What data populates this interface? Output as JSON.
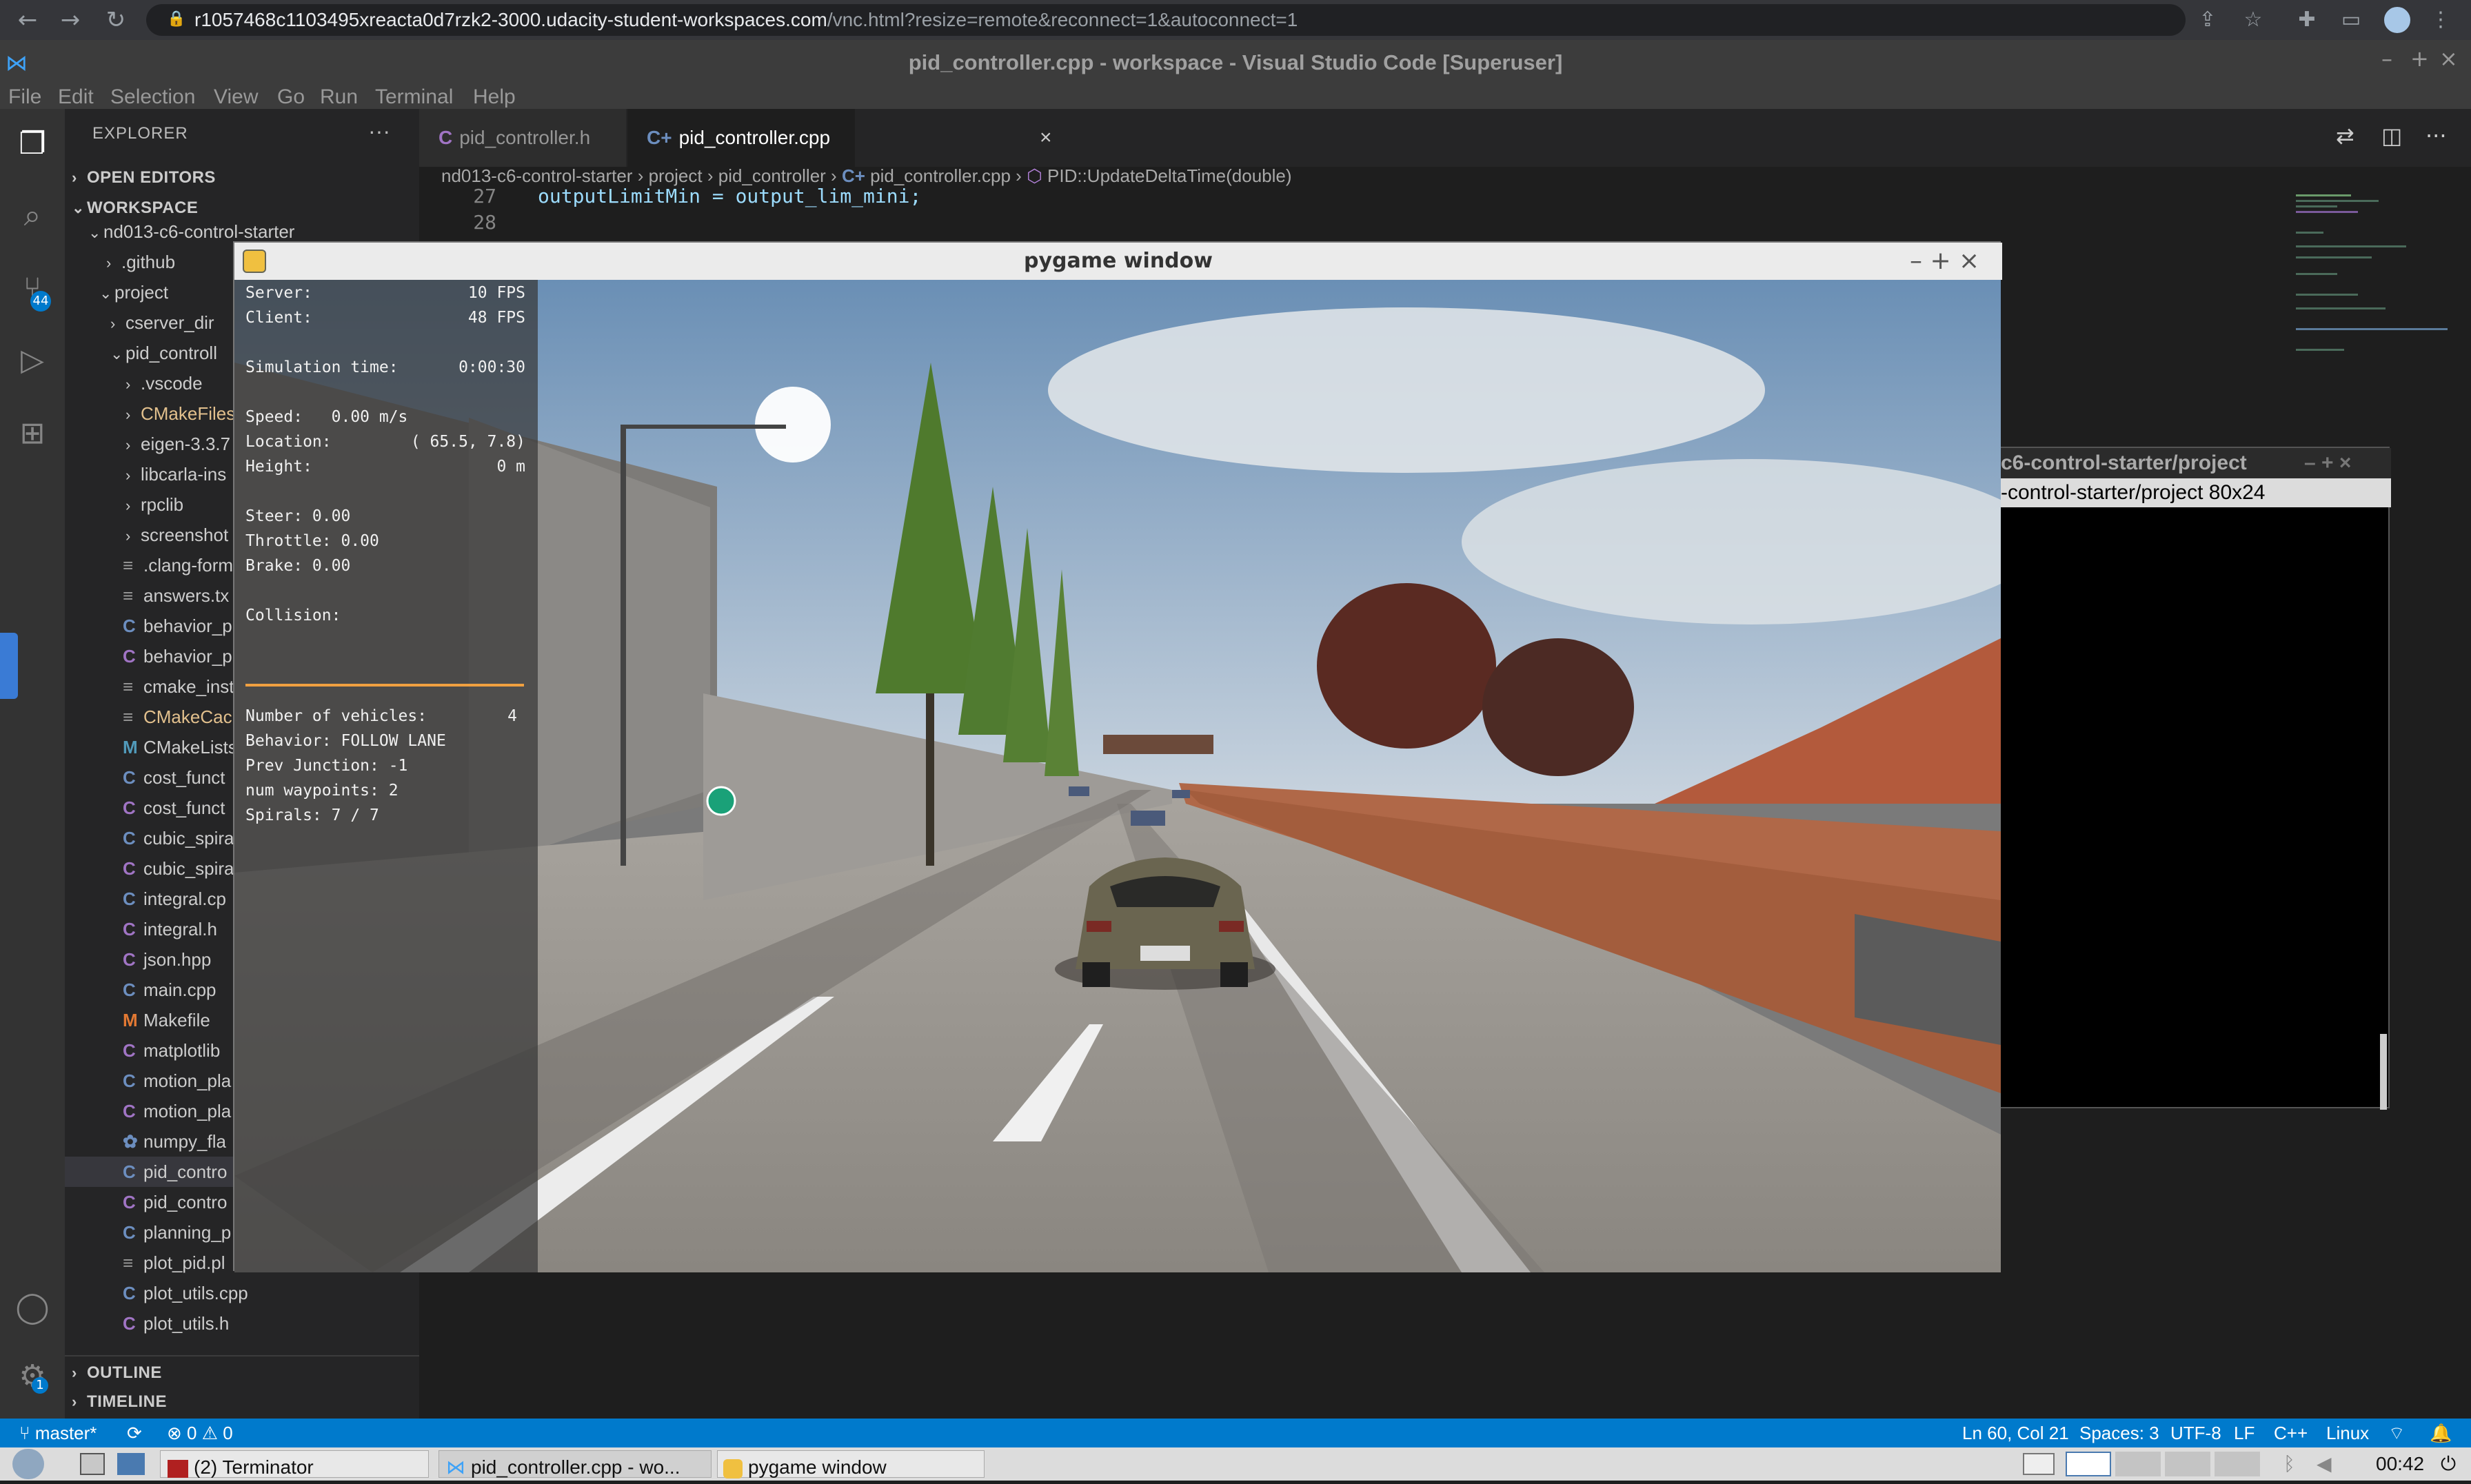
{
  "browser": {
    "url_host": "r1057468c1103495xreacta0d7rzk2-3000.udacity-student-workspaces.com",
    "url_path": "/vnc.html?resize=remote&reconnect=1&autoconnect=1"
  },
  "vscode": {
    "title": "pid_controller.cpp - workspace - Visual Studio Code [Superuser]",
    "menu": [
      "File",
      "Edit",
      "Selection",
      "View",
      "Go",
      "Run",
      "Terminal",
      "Help"
    ],
    "scm_badge": "44",
    "settings_badge": "1",
    "explorer": {
      "header": "EXPLORER",
      "open_editors": "OPEN EDITORS",
      "workspace": "WORKSPACE",
      "root": "nd013-c6-control-starter",
      "items": [
        {
          "label": ".github"
        },
        {
          "label": "project"
        },
        {
          "label": "cserver_dir"
        },
        {
          "label": "pid_controll"
        },
        {
          "label": ".vscode"
        },
        {
          "label": "CMakeFiles"
        },
        {
          "label": "eigen-3.3.7"
        },
        {
          "label": "libcarla-ins"
        },
        {
          "label": "rpclib"
        },
        {
          "label": "screenshot"
        },
        {
          "label": ".clang-form"
        },
        {
          "label": "answers.tx"
        },
        {
          "label": "behavior_p"
        },
        {
          "label": "behavior_p"
        },
        {
          "label": "cmake_inst"
        },
        {
          "label": "CMakeCach"
        },
        {
          "label": "CMakeLists"
        },
        {
          "label": "cost_funct"
        },
        {
          "label": "cost_funct"
        },
        {
          "label": "cubic_spira"
        },
        {
          "label": "cubic_spira"
        },
        {
          "label": "integral.cp"
        },
        {
          "label": "integral.h"
        },
        {
          "label": "json.hpp"
        },
        {
          "label": "main.cpp"
        },
        {
          "label": "Makefile"
        },
        {
          "label": "matplotlib"
        },
        {
          "label": "motion_pla"
        },
        {
          "label": "motion_pla"
        },
        {
          "label": "numpy_fla"
        },
        {
          "label": "pid_contro"
        },
        {
          "label": "pid_contro"
        },
        {
          "label": "planning_p"
        },
        {
          "label": "plot_pid.pl"
        },
        {
          "label": "plot_utils.cpp"
        },
        {
          "label": "plot_utils.h"
        }
      ],
      "outline": "OUTLINE",
      "timeline": "TIMELINE"
    },
    "tabs": [
      {
        "label": "pid_controller.h",
        "icon": "C"
      },
      {
        "label": "pid_controller.cpp",
        "icon": "C+"
      }
    ],
    "breadcrumbs": [
      "nd013-c6-control-starter",
      "project",
      "pid_controller",
      "pid_controller.cpp",
      "PID::UpdateDeltaTime(double)"
    ],
    "code": [
      {
        "line": "27",
        "text": "outputLimitMin = output_lim_mini;"
      },
      {
        "line": "28",
        "text": ""
      }
    ]
  },
  "terminal": {
    "title": "c6-control-starter/project",
    "subtitle": "-control-starter/project 80x24"
  },
  "pygame": {
    "title": "pygame window",
    "hud": {
      "server_label": "Server:",
      "server_value": "10 FPS",
      "client_label": "Client:",
      "client_value": "48 FPS",
      "sim_label": "Simulation time:",
      "sim_value": "0:00:30",
      "speed": "Speed:   0.00 m/s",
      "location_label": "Location:",
      "location_value": "( 65.5,   7.8)",
      "height_label": "Height:",
      "height_value": "0 m",
      "steer": "Steer: 0.00",
      "throttle": "Throttle: 0.00",
      "brake": "Brake: 0.00",
      "collision": "Collision:",
      "vehicles_label": "Number of vehicles:",
      "vehicles_value": "4",
      "behavior": "Behavior: FOLLOW LANE",
      "junction": "Prev Junction: -1",
      "waypoints": "num waypoints: 2",
      "spirals": "Spirals: 7 / 7"
    }
  },
  "statusbar": {
    "branch": "master*",
    "errors": "0",
    "warnings": "0",
    "position": "Ln 60, Col 21",
    "spaces": "Spaces: 3",
    "encoding": "UTF-8",
    "eol": "LF",
    "language": "C++",
    "os": "Linux"
  },
  "taskbar": {
    "items": [
      "(2) Terminator",
      "pid_controller.cpp - wo...",
      "pygame window"
    ],
    "clock": "00:42"
  }
}
